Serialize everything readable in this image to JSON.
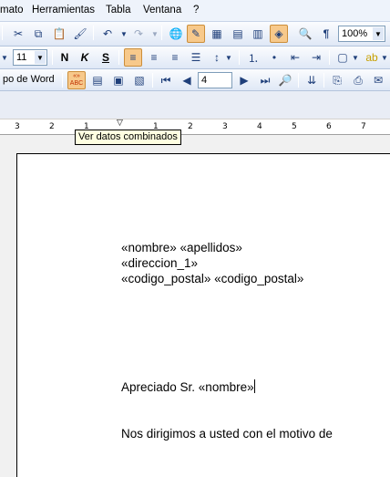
{
  "menu": {
    "formato": "mato",
    "herramientas": "Herramientas",
    "tabla": "Tabla",
    "ventana": "Ventana",
    "ayuda": "?"
  },
  "toolbar_standard": {
    "zoom_value": "100%"
  },
  "toolbar_format": {
    "font_size": "11",
    "bold_label": "N",
    "italic_label": "K",
    "underline_label": "S"
  },
  "toolbar_mail_merge": {
    "main_doc_type_label": "po de Word",
    "record_number": "4",
    "view_merged_data_label": "«»\nABC"
  },
  "tooltip": {
    "text": "Ver datos combinados"
  },
  "ruler": {
    "numbers": [
      "3",
      "2",
      "1",
      "1",
      "2",
      "3",
      "4",
      "5",
      "6",
      "7"
    ]
  },
  "document": {
    "line1": "«nombre» «apellidos»",
    "line2": "«direccion_1»",
    "line3": "«codigo_postal» «codigo_postal»",
    "greeting": "Apreciado Sr. «nombre»",
    "body": "Nos dirigimos a usted con el motivo de"
  },
  "colors": {
    "toolbar_bg": "#dfe8f6",
    "active_button": "#f7c98b",
    "tooltip_bg": "#ffffe1"
  }
}
